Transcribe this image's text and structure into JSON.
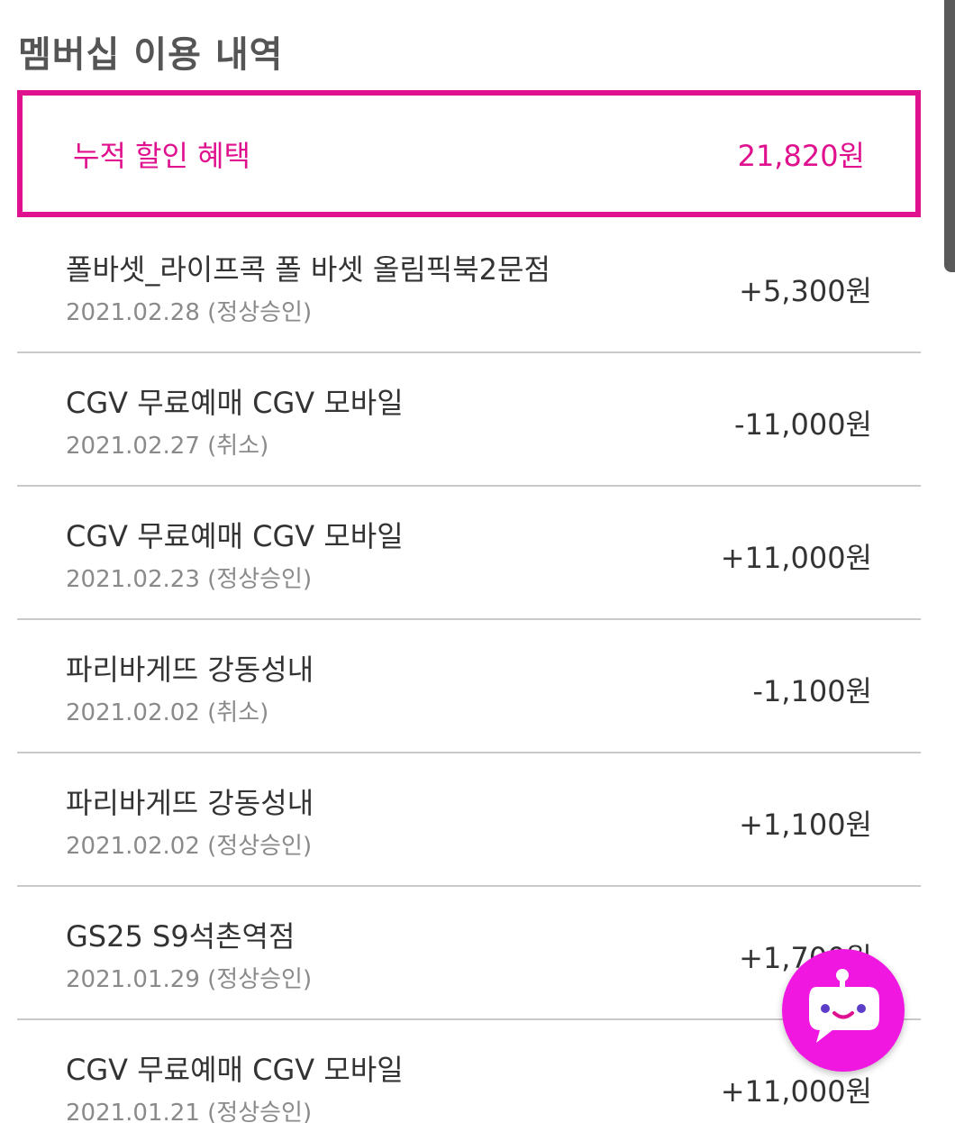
{
  "page_title": "멤버십 이용 내역",
  "summary": {
    "label": "누적 할인 혜택",
    "value": "21,820원"
  },
  "transactions": [
    {
      "name": "폴바셋_라이프콕 폴 바셋 올림픽북2문점",
      "date": "2021.02.28",
      "status": "(정상승인)",
      "amount": "+5,300원"
    },
    {
      "name": "CGV 무료예매 CGV 모바일",
      "date": "2021.02.27",
      "status": "(취소)",
      "amount": "-11,000원"
    },
    {
      "name": "CGV 무료예매 CGV 모바일",
      "date": "2021.02.23",
      "status": "(정상승인)",
      "amount": "+11,000원"
    },
    {
      "name": "파리바게뜨 강동성내",
      "date": "2021.02.02",
      "status": "(취소)",
      "amount": "-1,100원"
    },
    {
      "name": "파리바게뜨 강동성내",
      "date": "2021.02.02",
      "status": "(정상승인)",
      "amount": "+1,100원"
    },
    {
      "name": "GS25 S9석촌역점",
      "date": "2021.01.29",
      "status": "(정상승인)",
      "amount": "+1,700원"
    },
    {
      "name": "CGV 무료예매 CGV 모바일",
      "date": "2021.01.21",
      "status": "(정상승인)",
      "amount": "+11,000원"
    }
  ],
  "colors": {
    "accent": "#e0118e",
    "chatbot": "#f018e0",
    "divider": "#c9c9c9"
  },
  "icons": {
    "chatbot": "chatbot-robot-icon"
  }
}
